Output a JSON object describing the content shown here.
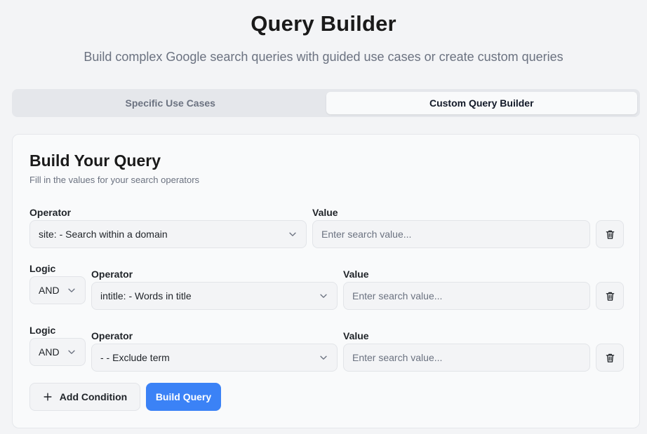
{
  "header": {
    "title": "Query Builder",
    "subtitle": "Build complex Google search queries with guided use cases or create custom queries"
  },
  "tabs": [
    {
      "label": "Specific Use Cases",
      "active": false
    },
    {
      "label": "Custom Query Builder",
      "active": true
    }
  ],
  "card": {
    "title": "Build Your Query",
    "description": "Fill in the values for your search operators"
  },
  "labels": {
    "operator": "Operator",
    "value": "Value",
    "logic": "Logic"
  },
  "conditions": [
    {
      "operator": "site: - Search within a domain",
      "value": "",
      "placeholder": "Enter search value..."
    },
    {
      "logic": "AND",
      "operator": "intitle: - Words in title",
      "value": "",
      "placeholder": "Enter search value..."
    },
    {
      "logic": "AND",
      "operator": "- - Exclude term",
      "value": "",
      "placeholder": "Enter search value..."
    }
  ],
  "actions": {
    "add_label": "Add Condition",
    "build_label": "Build Query"
  },
  "icons": {
    "chevron": "chevron-down-icon",
    "trash": "trash-icon",
    "plus": "plus-icon"
  },
  "colors": {
    "accent": "#3b82f6",
    "background": "#f3f4f6"
  }
}
